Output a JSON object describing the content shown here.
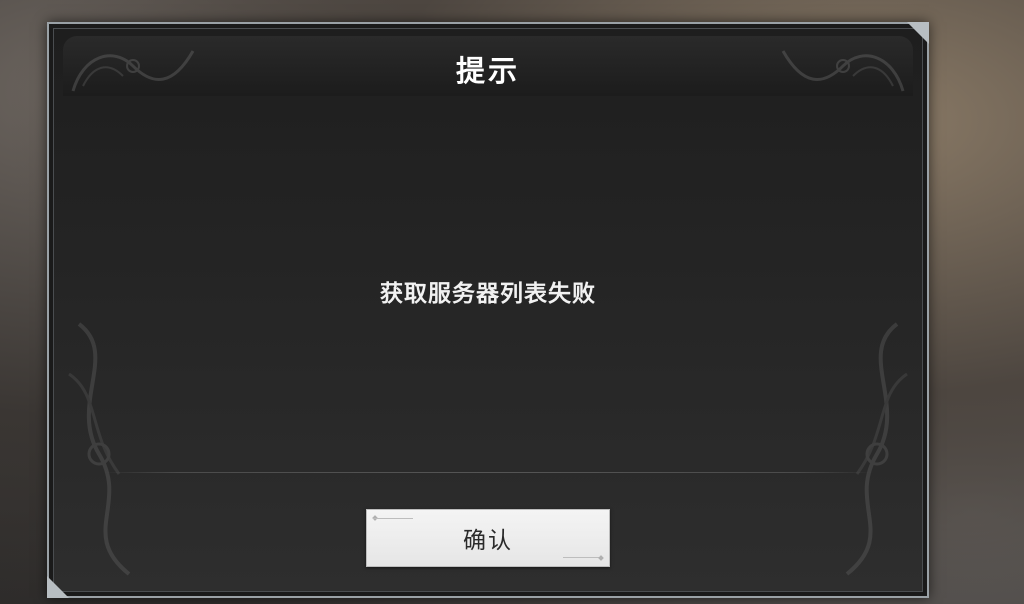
{
  "dialog": {
    "title": "提示",
    "message": "获取服务器列表失败",
    "confirm_label": "确认"
  },
  "icons": {
    "corner_ornament": "filigree-ornament-icon",
    "side_ornament": "scroll-ornament-icon"
  },
  "colors": {
    "dialog_border": "#9aa1a6",
    "dialog_bg": "#242424",
    "text": "#ffffff",
    "button_bg": "#eeeeee",
    "button_text": "#2a2a2a"
  }
}
